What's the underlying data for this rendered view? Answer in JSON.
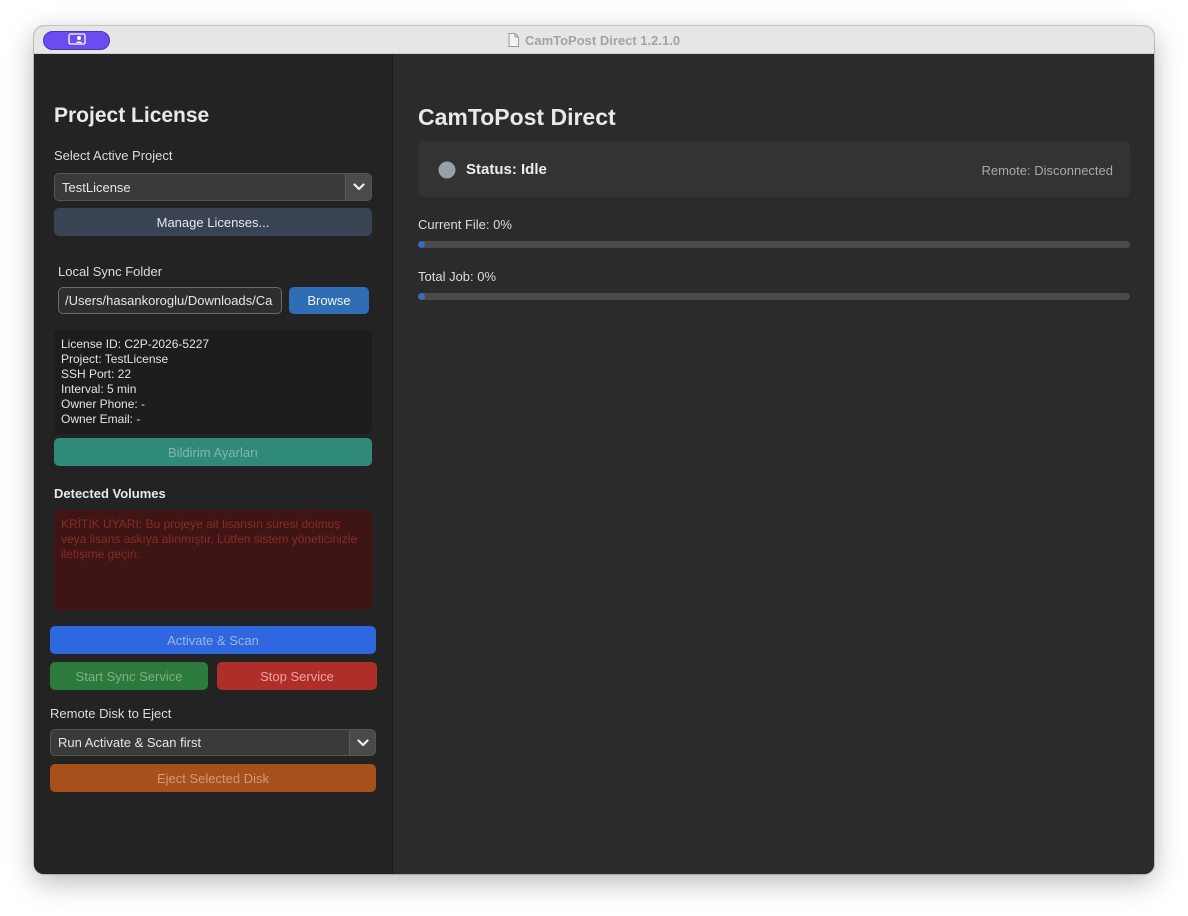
{
  "window": {
    "title": "CamToPost Direct 1.2.1.0"
  },
  "sidebar": {
    "title": "Project License",
    "project_label": "Select Active Project",
    "project_value": "TestLicense",
    "manage_label": "Manage Licenses...",
    "sync_label": "Local Sync Folder",
    "sync_value": "/Users/hasankoroglu/Downloads/Ca",
    "browse_label": "Browse",
    "info_lines": [
      "License ID: C2P-2026-5227",
      "Project: TestLicense",
      "SSH Port: 22",
      "Interval: 5 min",
      "Owner Phone: -",
      "Owner Email: -"
    ],
    "notify_label": "Bildirim Ayarları",
    "volumes_label": "Detected Volumes",
    "warning_text": "KRİTİK UYARI: Bu projeye ait lisansın süresi dolmuş veya lisans askıya alınmıştır. Lütfen sistem yöneticinizle iletişime geçin.",
    "activate_label": "Activate & Scan",
    "start_label": "Start Sync Service",
    "stop_label": "Stop Service",
    "eject_label": "Remote Disk to Eject",
    "eject_value": "Run Activate & Scan first",
    "eject_btn_label": "Eject Selected Disk"
  },
  "main": {
    "title": "CamToPost Direct",
    "status_text": "Status: Idle",
    "remote_text": "Remote: Disconnected",
    "current_file_label": "Current File: 0%",
    "current_file_progress": 0,
    "total_job_label": "Total Job: 0%",
    "total_job_progress": 0
  },
  "colors": {
    "accent_blue": "#2f67e0",
    "browse_blue": "#2f6db5",
    "green": "#2c7a3c",
    "red": "#b02e2a",
    "orange": "#a8501c",
    "teal": "#2f8a7a",
    "manage_slate": "#394354"
  },
  "icons": {
    "titlebar_badge": "person-card-icon",
    "title_doc": "document-icon",
    "dropdown": "chevron-down-icon",
    "status": "status-dot-icon"
  }
}
